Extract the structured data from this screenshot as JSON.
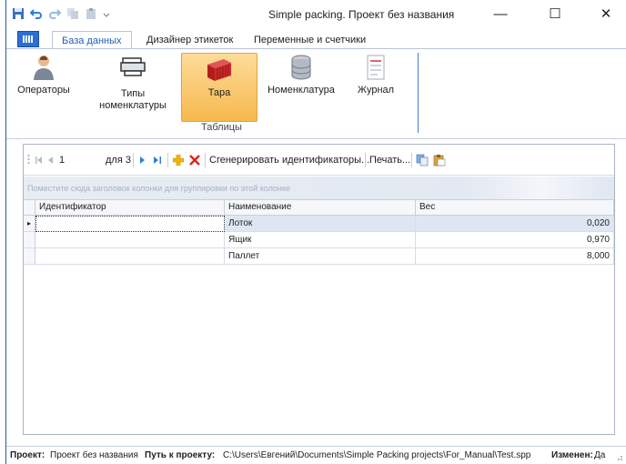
{
  "window": {
    "title": "Simple packing. Проект без названия",
    "minimize_glyph": "—",
    "maximize_glyph": "☐",
    "close_glyph": "✕"
  },
  "ribbon": {
    "tabs": [
      {
        "label": "База данных",
        "active": true
      },
      {
        "label": "Дизайнер этикеток",
        "active": false
      },
      {
        "label": "Переменные и счетчики",
        "active": false
      }
    ],
    "buttons": [
      {
        "label": "Операторы",
        "icon": "operator-icon"
      },
      {
        "label": "Типы номенклатуры",
        "icon": "printer-icon"
      },
      {
        "label": "Тара",
        "icon": "container-icon",
        "selected": true
      },
      {
        "label": "Номенклатура",
        "icon": "database-icon"
      },
      {
        "label": "Журнал",
        "icon": "journal-icon"
      }
    ],
    "group_caption": "Таблицы"
  },
  "navigator": {
    "page_value": "1",
    "of_label": "для 3",
    "generate_label": "Сгенерировать идентификаторы...",
    "print_label": "Печать..."
  },
  "grid": {
    "group_hint": "Поместите сюда заголовок колонки для группировки по этой колонке",
    "columns": [
      "Идентификатор",
      "Наименование",
      "Вес"
    ],
    "rows": [
      {
        "id": "",
        "name": "Лоток",
        "weight": "0,020"
      },
      {
        "id": "",
        "name": "Ящик",
        "weight": "0,970"
      },
      {
        "id": "",
        "name": "Паллет",
        "weight": "8,000"
      }
    ]
  },
  "status": {
    "project_label": "Проект:",
    "project_value": "Проект без названия",
    "path_label": "Путь к проекту:",
    "path_value": "C:\\Users\\Евгений\\Documents\\Simple Packing projects\\For_Manual\\Test.spp",
    "modified_label": "Изменен:",
    "modified_value": "Да"
  },
  "colors": {
    "accent": "#1f5fb0",
    "selected_button": "#f7b84d",
    "delete_red": "#e02020",
    "add_yellow": "#f0b400"
  }
}
